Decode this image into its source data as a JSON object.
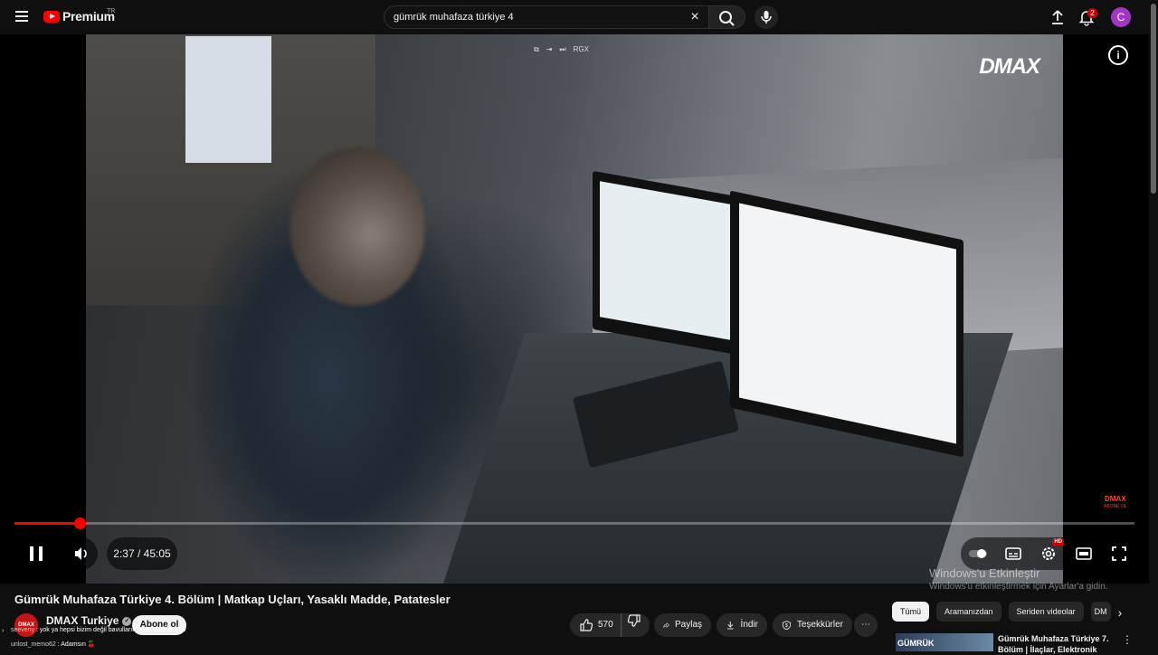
{
  "topbar": {
    "logo_text": "Premium",
    "logo_country": "TR",
    "search_value": "gümrük muhafaza türkiye 4",
    "clear_icon": "×",
    "notification_count": "2",
    "avatar_initial": "C"
  },
  "player": {
    "top_controls": [
      "⧉",
      "⇥",
      "⏭",
      "RGX"
    ],
    "watermark": "DMAX",
    "small_watermark_line1": "DMAX",
    "small_watermark_line2": "ABONE OL",
    "info_icon": "i",
    "progress_fraction": 0.0585,
    "time_display": "2:37 / 45:05",
    "hd_badge": "HD"
  },
  "windows_activation": {
    "line1": "Windows'u Etkinleştir",
    "line2": "Windows'u etkinleştirmek için Ayarlar'a gidin."
  },
  "video": {
    "title": "Gümrük Muhafaza Türkiye 4. Bölüm | Matkap Uçları, Yasaklı Madde, Patatesler",
    "channel_avatar_text": "DMAX",
    "channel_name": "DMAX Turkiye",
    "subscribe_label": "Abone ol",
    "like_count": "570",
    "share_label": "Paylaş",
    "download_label": "İndir",
    "thanks_label": "Teşekkürler",
    "more_label": "⋯"
  },
  "chat": {
    "line1_user": "seeveny",
    "line1_text": " : yok ya hepsi bizim değil bavulların hepsi seçiyor yav",
    "line2_user": "unlost_memo62",
    "line2_text": " : Adamsın 🍒"
  },
  "sidebar": {
    "chips": [
      "Tümü",
      "Aramanızdan",
      "Seriden videolar",
      "DM"
    ],
    "next_label": "›",
    "rec_thumb_text": "GÜMRÜK",
    "rec_title": "Gümrük Muhafaza Türkiye 7. Bölüm | İlaçlar, Elektronik",
    "rec_more": "⋮"
  },
  "colors": {
    "accent_red": "#ff0000",
    "background": "#0f0f0f",
    "avatar": "#a535c7"
  }
}
